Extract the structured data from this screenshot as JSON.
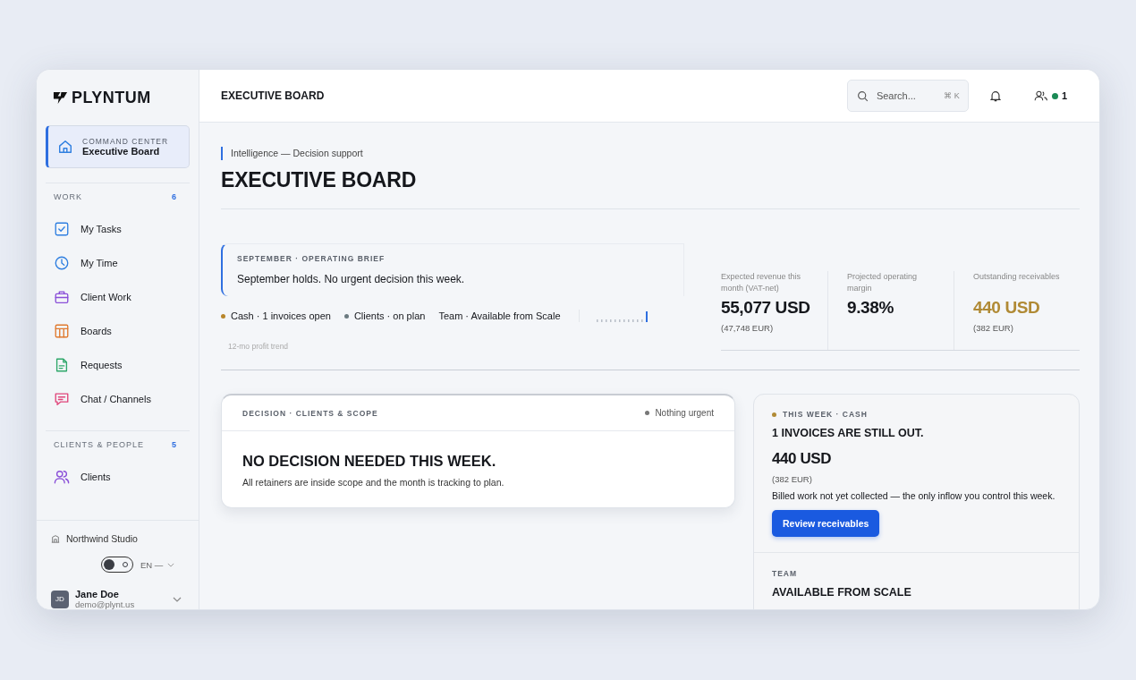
{
  "sidebar": {
    "logo": "PLYNTUM",
    "active": {
      "eyebrow": "COMMAND CENTER",
      "label": "Executive Board",
      "selected": true
    },
    "sections": [
      {
        "title": "WORK",
        "count": "6",
        "items": [
          {
            "label": "My Tasks",
            "color": "#2f7fe0"
          },
          {
            "label": "My Time",
            "color": "#2f7fe0"
          },
          {
            "label": "Client Work",
            "color": "#8a4fd8"
          },
          {
            "label": "Boards",
            "color": "#e07a2f"
          },
          {
            "label": "Requests",
            "color": "#2fa86a"
          },
          {
            "label": "Chat / Channels",
            "color": "#e0457a"
          }
        ]
      },
      {
        "title": "CLIENTS & PEOPLE",
        "count": "5",
        "items": [
          {
            "label": "Clients",
            "color": "#8a4fd8"
          }
        ]
      }
    ],
    "workspace": "Northwind Studio",
    "dark_mode": false,
    "language": "EN —",
    "user": {
      "initials": "JD",
      "name": "Jane Doe",
      "email": "demo@plynt.us"
    }
  },
  "header": {
    "title": "EXECUTIVE BOARD",
    "search": {
      "placeholder": "Search...",
      "shortcut": "⌘ K"
    },
    "online_count": "1"
  },
  "page": {
    "eyebrow": "Intelligence — Decision support",
    "title": "EXECUTIVE BOARD"
  },
  "brief": {
    "eyebrow": "SEPTEMBER · OPERATING BRIEF",
    "text": "September holds. No urgent decision this week.",
    "legend": [
      {
        "label": "Cash · 1 invoices open",
        "color": "#b8862a"
      },
      {
        "label": "Clients · on plan",
        "color": "#6b7a80"
      },
      {
        "label": "Team · Available from Scale"
      }
    ],
    "trend_label": "12-mo profit trend"
  },
  "metrics": [
    {
      "label": "Expected revenue this month (VAT-net)",
      "value": "55,077 USD",
      "sub": "(47,748 EUR)",
      "highlight": false
    },
    {
      "label": "Projected operating margin",
      "value": "9.38%",
      "highlight": false
    },
    {
      "label": "Outstanding receivables",
      "value": "440 USD",
      "sub": "(382 EUR)",
      "highlight": true
    }
  ],
  "decision": {
    "eyebrow": "DECISION · CLIENTS & SCOPE",
    "status": "Nothing urgent",
    "title": "NO DECISION NEEDED THIS WEEK.",
    "text": "All retainers are inside scope and the month is tracking to plan."
  },
  "cash": {
    "eyebrow": "THIS WEEK · CASH",
    "title": "1 INVOICES ARE STILL OUT.",
    "amount": "440 USD",
    "sub": "(382 EUR)",
    "text": "Billed work not yet collected — the only inflow you control this week.",
    "button": "Review receivables"
  },
  "team": {
    "eyebrow": "TEAM",
    "title": "AVAILABLE FROM SCALE"
  }
}
